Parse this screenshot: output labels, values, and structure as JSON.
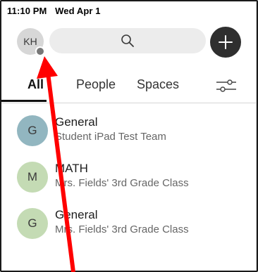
{
  "status_bar": {
    "time": "11:10 PM",
    "date": "Wed Apr 1"
  },
  "profile": {
    "initials": "KH"
  },
  "tabs": [
    {
      "label": "All",
      "active": true
    },
    {
      "label": "People",
      "active": false
    },
    {
      "label": "Spaces",
      "active": false
    }
  ],
  "icons": {
    "search": "search-icon",
    "compose": "plus-icon",
    "filter": "filter-sliders-icon",
    "annotation": "red-arrow-annotation"
  },
  "colors": {
    "accent": "#2f2f2f",
    "annotation_red": "#ff0000",
    "avatar_general_1": "#92b6c0",
    "avatar_math": "#c4dbb4",
    "avatar_general_2": "#c4dbb4"
  },
  "conversations": [
    {
      "initial": "G",
      "title": "General",
      "subtitle": "Student iPad Test Team",
      "avatar_color": "#92b6c0"
    },
    {
      "initial": "M",
      "title": "MATH",
      "subtitle": "Mrs. Fields' 3rd Grade Class",
      "avatar_color": "#c4dbb4"
    },
    {
      "initial": "G",
      "title": "General",
      "subtitle": "Mrs. Fields' 3rd Grade Class",
      "avatar_color": "#c4dbb4"
    }
  ]
}
